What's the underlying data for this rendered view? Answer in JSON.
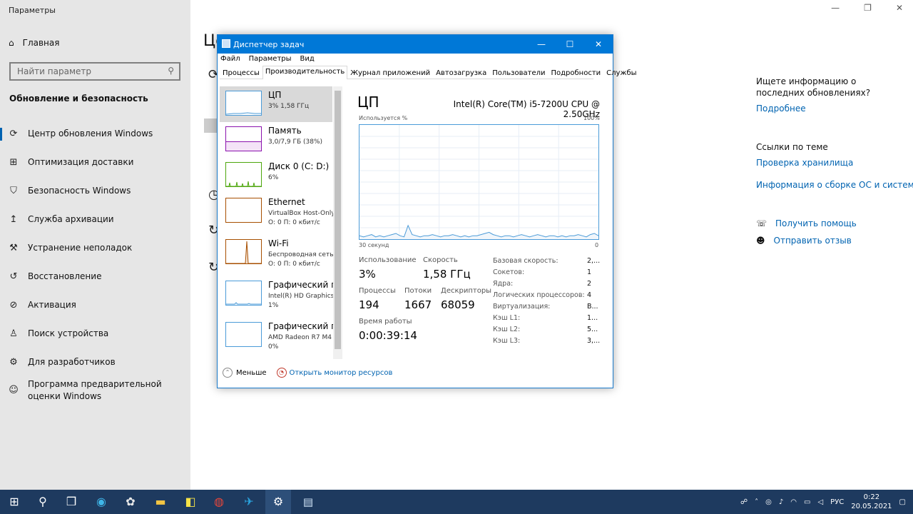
{
  "settings": {
    "title": "Параметры",
    "home_label": "Главная",
    "search_placeholder": "Найти параметр",
    "section_title": "Обновление и безопасность",
    "nav_items": [
      {
        "label": "Центр обновления Windows",
        "icon": "sync-icon"
      },
      {
        "label": "Оптимизация доставки",
        "icon": "delivery-icon"
      },
      {
        "label": "Безопасность Windows",
        "icon": "shield-icon"
      },
      {
        "label": "Служба архивации",
        "icon": "backup-icon"
      },
      {
        "label": "Устранение неполадок",
        "icon": "wrench-icon"
      },
      {
        "label": "Восстановление",
        "icon": "recovery-icon"
      },
      {
        "label": "Активация",
        "icon": "check-circle-icon"
      },
      {
        "label": "Поиск устройства",
        "icon": "person-pin-icon"
      },
      {
        "label": "Для разработчиков",
        "icon": "developer-icon"
      },
      {
        "label": "Программа предварительной оценки Windows",
        "icon": "insider-icon"
      }
    ],
    "heading_fragment": "Цє",
    "right_panel": {
      "question": "Ищете информацию о последних обновлениях?",
      "more_link": "Подробнее",
      "related_title": "Ссылки по теме",
      "storage_link": "Проверка хранилища",
      "build_link": "Информация о сборке ОС и системе",
      "help_link": "Получить помощь",
      "feedback_link": "Отправить отзыв"
    }
  },
  "taskmgr": {
    "title": "Диспетчер задач",
    "menu": [
      "Файл",
      "Параметры",
      "Вид"
    ],
    "tabs": [
      "Процессы",
      "Производительность",
      "Журнал приложений",
      "Автозагрузка",
      "Пользователи",
      "Подробности",
      "Службы"
    ],
    "active_tab": "Производительность",
    "resources": [
      {
        "name": "ЦП",
        "sub1": "3% 1,58 ГГц",
        "sub2": ""
      },
      {
        "name": "Память",
        "sub1": "3,0/7,9 ГБ (38%)",
        "sub2": ""
      },
      {
        "name": "Диск 0 (C: D:)",
        "sub1": "6%",
        "sub2": ""
      },
      {
        "name": "Ethernet",
        "sub1": "VirtualBox Host-Only",
        "sub2": "О: 0 П: 0 кбит/с"
      },
      {
        "name": "Wi-Fi",
        "sub1": "Беспроводная сеть",
        "sub2": "О: 0 П: 0 кбит/с"
      },
      {
        "name": "Графический п",
        "sub1": "Intel(R) HD Graphics",
        "sub2": "1%"
      },
      {
        "name": "Графический п",
        "sub1": "AMD Radeon R7 M4",
        "sub2": "0%"
      }
    ],
    "less_label": "Меньше",
    "monitor_link": "Открыть монитор ресурсов",
    "cpu": {
      "title": "ЦП",
      "model": "Intel(R) Core(TM) i5-7200U CPU @ 2.50GHz",
      "graph_label": "Используется %",
      "graph_max": "100%",
      "graph_time": "30 секунд",
      "graph_min": "0",
      "usage_label": "Использование",
      "usage": "3%",
      "speed_label": "Скорость",
      "speed": "1,58 ГГц",
      "proc_label": "Процессы",
      "proc": "194",
      "threads_label": "Потоки",
      "threads": "1667",
      "handles_label": "Дескрипторы",
      "handles": "68059",
      "uptime_label": "Время работы",
      "uptime": "0:00:39:14",
      "details": [
        {
          "label": "Базовая скорость:",
          "value": "2,..."
        },
        {
          "label": "Сокетов:",
          "value": "1"
        },
        {
          "label": "Ядра:",
          "value": "2"
        },
        {
          "label": "Логических процессоров:",
          "value": "4"
        },
        {
          "label": "Виртуализация:",
          "value": "В..."
        },
        {
          "label": "Кэш L1:",
          "value": "1..."
        },
        {
          "label": "Кэш L2:",
          "value": "5..."
        },
        {
          "label": "Кэш L3:",
          "value": "3,..."
        }
      ],
      "history": [
        3,
        2,
        3,
        4,
        2,
        3,
        2,
        3,
        4,
        5,
        3,
        2,
        12,
        4,
        3,
        2,
        3,
        3,
        4,
        3,
        2,
        3,
        3,
        4,
        3,
        2,
        3,
        2,
        3,
        3,
        4,
        5,
        6,
        4,
        3,
        2,
        3,
        3,
        2,
        3,
        4,
        3,
        2,
        3,
        4,
        3,
        2,
        3,
        3,
        2,
        3,
        2,
        3,
        3,
        4,
        3,
        2,
        4,
        5,
        3
      ]
    }
  },
  "taskbar": {
    "lang": "РУС",
    "time": "0:22",
    "date": "20.05.2021"
  },
  "colors": {
    "accent": "#0078d7",
    "cpu": "#4b9bd8",
    "memory": "#8b12ae",
    "disk": "#4da60c",
    "net": "#a74f01"
  }
}
